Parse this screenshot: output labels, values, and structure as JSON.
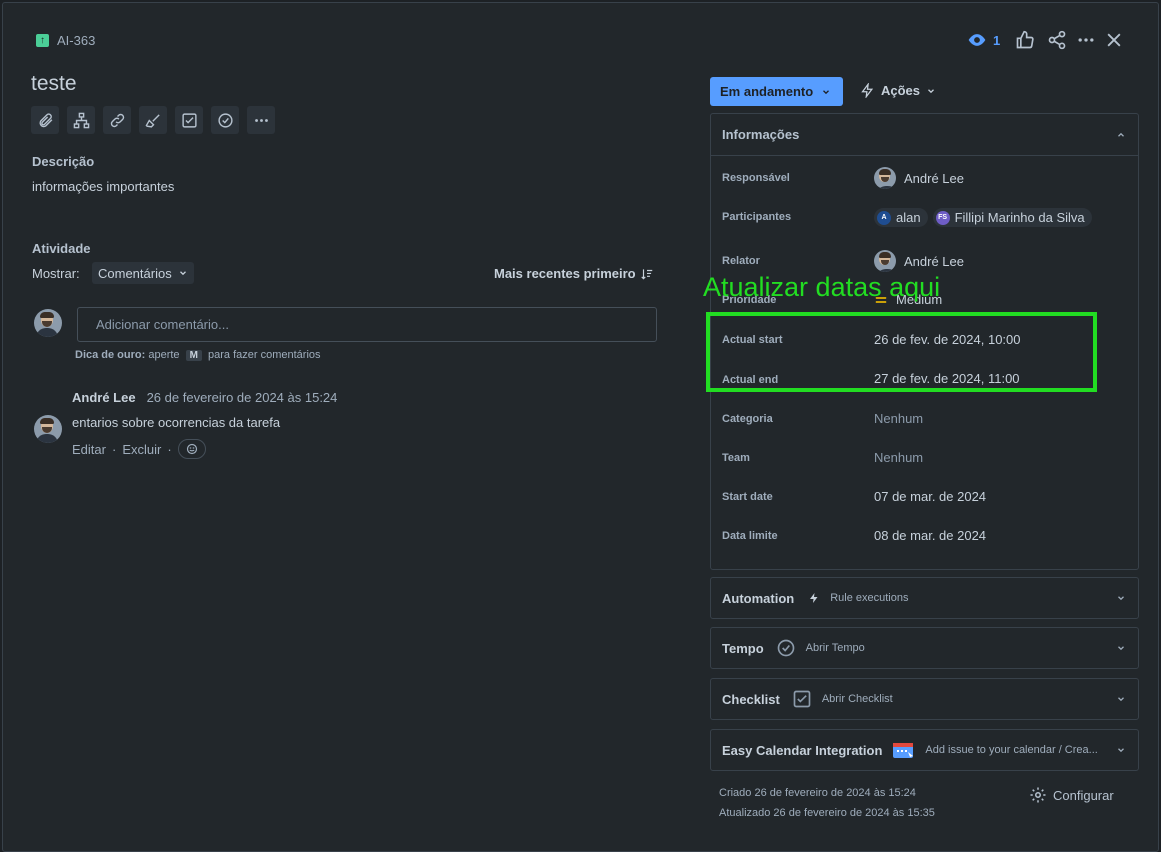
{
  "issue": {
    "key": "AI-363",
    "title": "teste"
  },
  "header": {
    "watchers_count": "1",
    "icons": [
      "eye-icon",
      "thumbs-up-icon",
      "share-icon",
      "more-icon",
      "close-icon"
    ]
  },
  "toolbar": {
    "icons": [
      "paperclip-icon",
      "hierarchy-icon",
      "link-icon",
      "broom-icon",
      "checkbox-icon",
      "check-circle-icon",
      "more-icon"
    ]
  },
  "description": {
    "label": "Descrição",
    "text": "informações importantes"
  },
  "activity": {
    "label": "Atividade",
    "show_label": "Mostrar:",
    "show_value": "Comentários",
    "sort_label": "Mais recentes primeiro",
    "comment_placeholder": "Adicionar comentário...",
    "tip_bold": "Dica de ouro:",
    "tip_pre": "aperte",
    "tip_key": "M",
    "tip_post": "para fazer comentários",
    "comments": [
      {
        "author": "André Lee",
        "date": "26 de fevereiro de 2024 às 15:24",
        "text": "entarios sobre ocorrencias da tarefa",
        "edit_label": "Editar",
        "delete_label": "Excluir"
      }
    ]
  },
  "status": {
    "label": "Em andamento",
    "actions_label": "Ações"
  },
  "info_panel": {
    "title": "Informações",
    "fields": {
      "assignee": {
        "label": "Responsável",
        "value": "André Lee"
      },
      "participants": {
        "label": "Participantes",
        "values": [
          {
            "initials": "A",
            "name": "alan",
            "color": "#1f4d91"
          },
          {
            "initials": "FS",
            "name": "Fillipi Marinho da Silva",
            "color": "#6e5dc6"
          }
        ]
      },
      "reporter": {
        "label": "Relator",
        "value": "André Lee"
      },
      "priority": {
        "label": "Prioridade",
        "value": "Medium"
      },
      "actual_start": {
        "label": "Actual start",
        "value": "26 de fev. de 2024, 10:00"
      },
      "actual_end": {
        "label": "Actual end",
        "value": "27 de fev. de 2024, 11:00"
      },
      "category": {
        "label": "Categoria",
        "value": "Nenhum"
      },
      "team": {
        "label": "Team",
        "value": "Nenhum"
      },
      "start_date": {
        "label": "Start date",
        "value": "07 de mar. de 2024"
      },
      "due_date": {
        "label": "Data limite",
        "value": "08 de mar. de 2024"
      }
    }
  },
  "sections": {
    "automation": {
      "name": "Automation",
      "sub": "Rule executions"
    },
    "tempo": {
      "name": "Tempo",
      "sub": "Abrir Tempo"
    },
    "checklist": {
      "name": "Checklist",
      "sub": "Abrir Checklist"
    },
    "calendar": {
      "name": "Easy Calendar Integration",
      "sub": "Add issue to your calendar / Crea..."
    }
  },
  "footer": {
    "created": "Criado 26 de fevereiro de 2024 às 15:24",
    "updated": "Atualizado 26 de fevereiro de 2024 às 15:35",
    "configure_label": "Configurar"
  },
  "annotation": {
    "text": "Atualizar datas aqui",
    "color": "#22dd22"
  },
  "colors": {
    "accent": "#579dff",
    "story": "#4bce97"
  }
}
